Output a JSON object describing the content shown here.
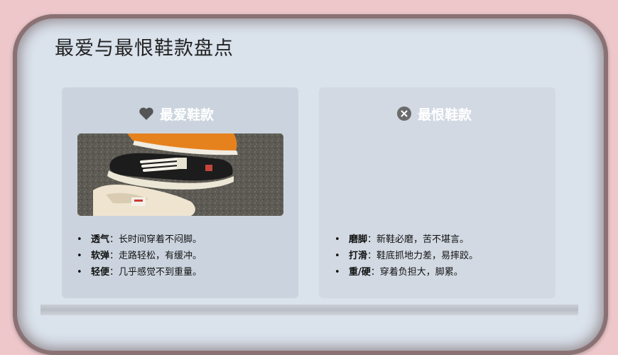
{
  "slide": {
    "title": "最爱与最恨鞋款盘点"
  },
  "love_card": {
    "heading": "最爱鞋款",
    "icon": "heart-icon",
    "points": [
      {
        "key": "透气",
        "sep": "：",
        "text": "长时间穿着不闷脚。"
      },
      {
        "key": "软弹",
        "sep": "：",
        "text": "走路轻松，有缓冲。"
      },
      {
        "key": "轻便",
        "sep": "：",
        "text": "几乎感觉不到重量。"
      }
    ]
  },
  "hate_card": {
    "heading": "最恨鞋款",
    "icon": "close-circle-icon",
    "points": [
      {
        "key": "磨脚",
        "sep": "：",
        "text": "新鞋必磨，苦不堪言。"
      },
      {
        "key": "打滑",
        "sep": "：",
        "text": "鞋底抓地力差，易摔跤。"
      },
      {
        "key": "重/硬",
        "sep": "：",
        "text": "穿着负担大，脚累。"
      }
    ]
  },
  "colors": {
    "background": "#eec7cb",
    "slide": "#dae2ec",
    "card_left": "#cbd4de",
    "card_right": "#d2d9e3",
    "heading_text": "#ffffff",
    "icon": "#555555"
  }
}
